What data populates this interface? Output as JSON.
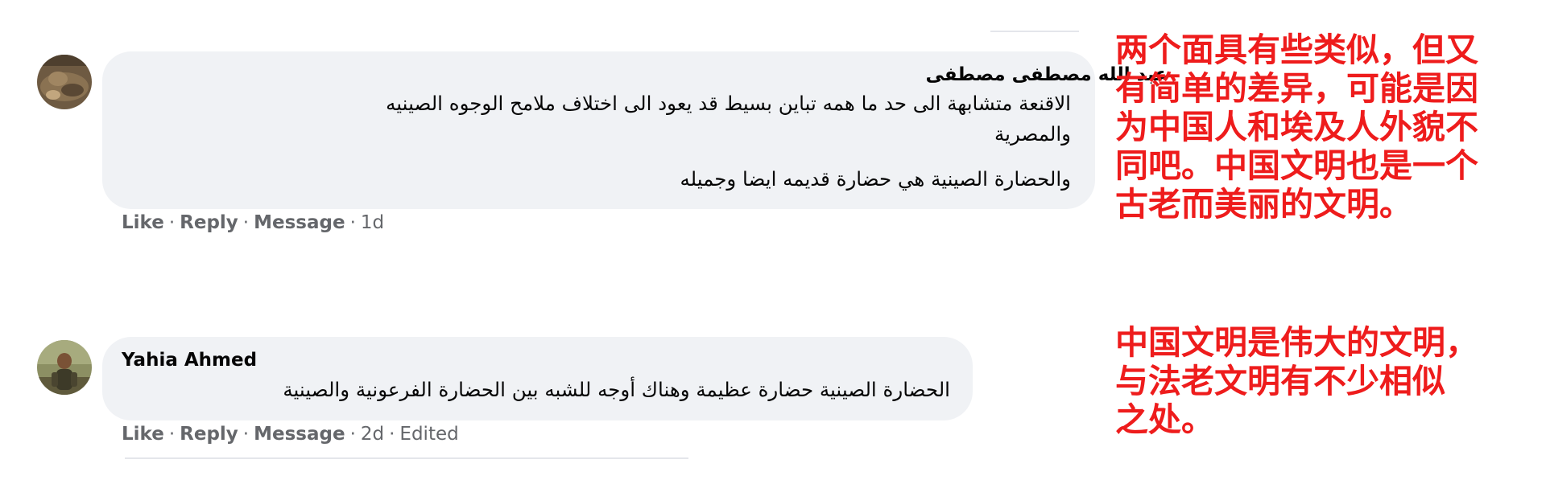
{
  "comments": [
    {
      "author": "عبد الله مصطفى مصطفى",
      "lines": [
        "الاقنعة متشابهة الى حد ما همه تباين بسيط قد يعود الى اختلاف ملامح الوجوه الصينيه",
        "والمصرية",
        "والحضارة الصينية هي حضارة قديمه ايضا وجميله"
      ],
      "actions": {
        "like": "Like",
        "reply": "Reply",
        "message": "Message",
        "time": "1d"
      },
      "avatar_icon": "profile-photo"
    },
    {
      "author": "Yahia Ahmed",
      "lines": [
        "الحضارة الصينية حضارة عظيمة وهناك أوجه للشبه بين الحضارة الفرعونية والصينية"
      ],
      "actions": {
        "like": "Like",
        "reply": "Reply",
        "message": "Message",
        "time": "2d",
        "edited": "Edited"
      },
      "avatar_icon": "profile-photo"
    }
  ],
  "annotations": {
    "first": [
      "两个面具有些类似，但又",
      "有简单的差异，可能是因",
      "为中国人和埃及人外貌不",
      "同吧。中国文明也是一个",
      "古老而美丽的文明。"
    ],
    "second": [
      "中国文明是伟大的文明，",
      "与法老文明有不少相似",
      "之处。"
    ]
  },
  "colors": {
    "annotation": "#ee1c1c",
    "bubble": "#f0f2f5",
    "secondary_text": "#65676b"
  }
}
